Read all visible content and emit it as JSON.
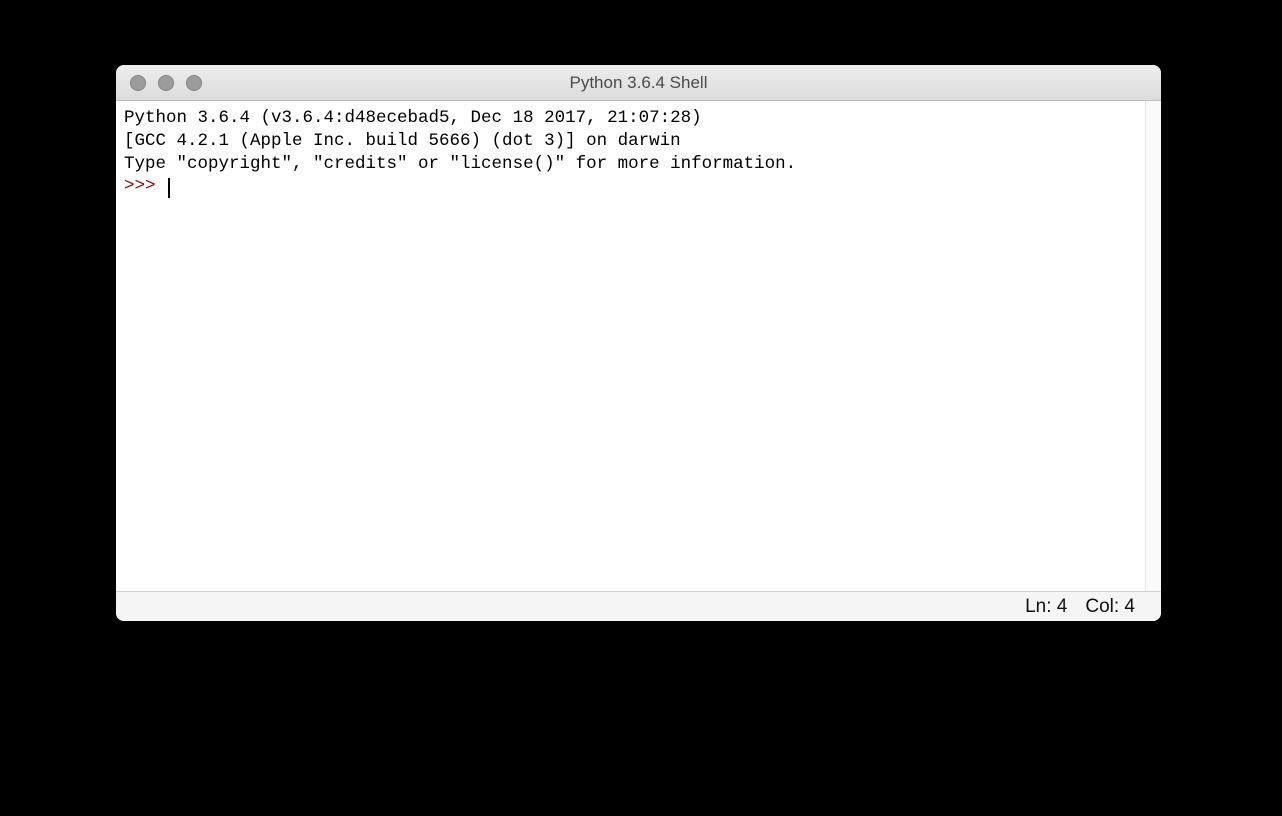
{
  "window": {
    "title": "Python 3.6.4 Shell"
  },
  "shell": {
    "line1": "Python 3.6.4 (v3.6.4:d48ecebad5, Dec 18 2017, 21:07:28) ",
    "line2": "[GCC 4.2.1 (Apple Inc. build 5666) (dot 3)] on darwin",
    "line3": "Type \"copyright\", \"credits\" or \"license()\" for more information.",
    "prompt": ">>> "
  },
  "status": {
    "line_label": "Ln: 4",
    "col_label": "Col: 4"
  }
}
